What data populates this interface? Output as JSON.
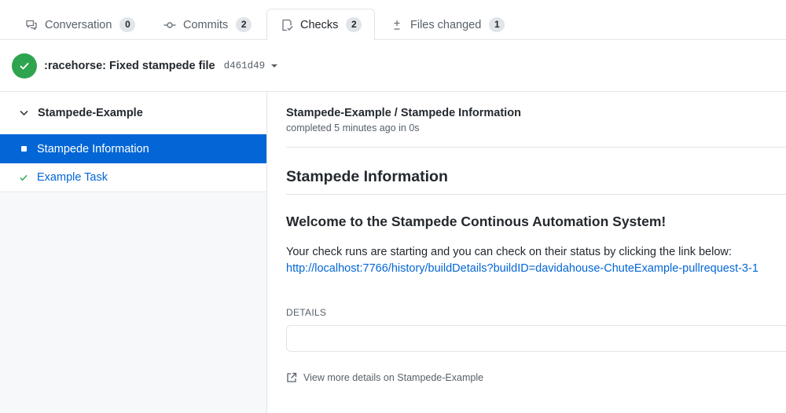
{
  "tabs": [
    {
      "label": "Conversation",
      "count": "0",
      "icon": "comment-discussion-icon"
    },
    {
      "label": "Commits",
      "count": "2",
      "icon": "git-commit-icon"
    },
    {
      "label": "Checks",
      "count": "2",
      "icon": "checklist-icon"
    },
    {
      "label": "Files changed",
      "count": "1",
      "icon": "file-diff-icon"
    }
  ],
  "commit": {
    "title": ":racehorse: Fixed stampede file",
    "sha": "d461d49",
    "status_color": "#2ea44f"
  },
  "sidebar": {
    "suite_name": "Stampede-Example",
    "runs": [
      {
        "label": "Stampede Information",
        "state": "in_progress"
      },
      {
        "label": "Example Task",
        "state": "success"
      }
    ]
  },
  "main": {
    "run_name": "Stampede-Example / Stampede Information",
    "run_meta": "completed 5 minutes ago in 0s",
    "summary_title": "Stampede Information",
    "welcome": "Welcome to the Stampede Continous Automation System!",
    "paragraph": "Your check runs are starting and you can check on their status by clicking the link below:",
    "link": "http://localhost:7766/history/buildDetails?buildID=davidahouse-ChuteExample-pullrequest-3-1",
    "details_label": "DETAILS",
    "more_details": "View more details on Stampede-Example"
  },
  "colors": {
    "accent": "#0366d6",
    "success": "#2ea44f"
  }
}
